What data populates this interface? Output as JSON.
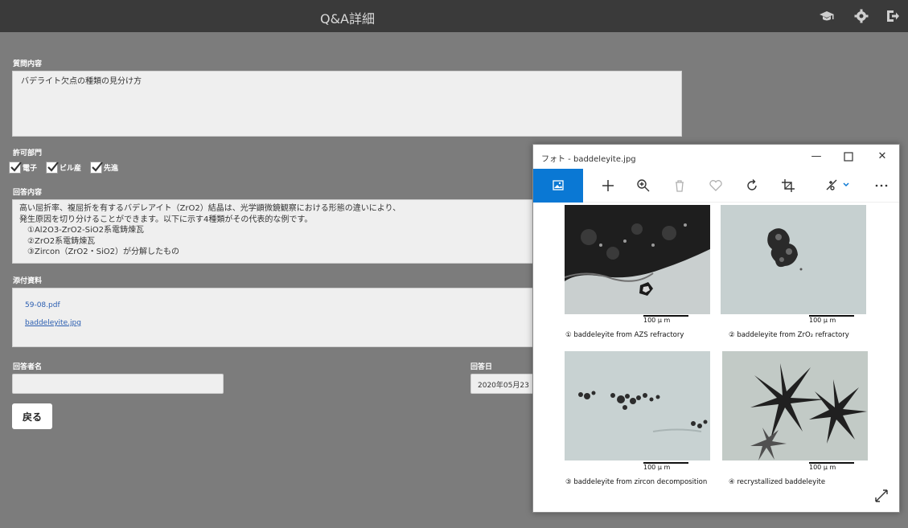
{
  "header": {
    "title": "Q&A詳細"
  },
  "question": {
    "label": "質問内容",
    "text": "バデライト欠点の種類の見分け方"
  },
  "departments": {
    "label": "許可部門",
    "items": [
      {
        "label": "電子",
        "checked": true
      },
      {
        "label": "ビル産",
        "checked": true
      },
      {
        "label": "先進",
        "checked": true
      }
    ]
  },
  "answer": {
    "label": "回答内容",
    "lines": [
      "高い屈折率、複屈折を有するバデレアイト（ZrO2）結晶は、光学顕微鏡観察における形態の違いにより、",
      "発生原因を切り分けることができます。以下に示す4種類がその代表的な例です。",
      "　①Al2O3-ZrO2-SiO2系電鋳煉瓦",
      "　②ZrO2系電鋳煉瓦",
      "　③Zircon（ZrO2・SiO2）が分解したもの"
    ]
  },
  "attachments": {
    "label": "添付資料",
    "files": [
      "59-08.pdf",
      "baddeleyite.jpg"
    ]
  },
  "responder": {
    "label": "回答者名",
    "value": ""
  },
  "answer_date": {
    "label": "回答日",
    "value": "2020年05月23"
  },
  "back_button": {
    "label": "戻る"
  },
  "photo_window": {
    "title": "フォト - baddeleyite.jpg",
    "toolbar_icons": [
      "image-icon",
      "plus-icon",
      "zoom-in-icon",
      "trash-icon",
      "heart-icon",
      "rotate-icon",
      "crop-icon",
      "edit-icon",
      "more-icon"
    ],
    "scale_label": "100 μ m",
    "captions": [
      "① baddeleyite from AZS refractory",
      "② baddeleyite from ZrO₂ refractory",
      "③ baddeleyite from zircon decomposition",
      "④ recrystallized baddeleyite"
    ]
  },
  "colors": {
    "background": "#7c7c7c",
    "topbar": "#3a3a3a",
    "accent": "#0a78d4",
    "link": "#2a5db0"
  }
}
